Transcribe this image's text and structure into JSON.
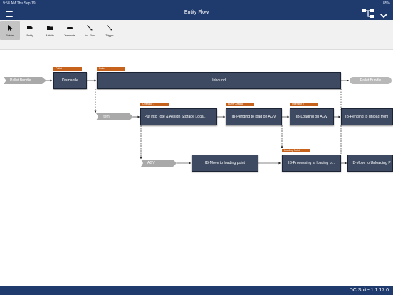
{
  "status": {
    "time": "9:58 AM",
    "date": "Thu Sep 19",
    "right": "85%"
  },
  "nav": {
    "title": "Entity Flow"
  },
  "toolbar": {
    "tools": [
      {
        "label": "Pointer"
      },
      {
        "label": "Entity"
      },
      {
        "label": "Activity"
      },
      {
        "label": "Terminate"
      },
      {
        "label": "Act. Flow"
      },
      {
        "label": "Trigger"
      }
    ]
  },
  "flow": {
    "row1": {
      "start": "Pallet Bundle",
      "tag_dismantle": "Pallet",
      "dismantle": "Dismantle",
      "tag_inbound": "Pallet",
      "inbound": "Inbound",
      "end": "Pallet Bundle"
    },
    "row2": {
      "start": "Item",
      "tag1": "Operator 1",
      "step1": "Put into Tote & Assign Storage Loca...",
      "tag2": "Buffer Area A",
      "step2": "IB-Pending to load on AGV",
      "tag3": "Operator 2",
      "step3": "IB-Loading on AGV",
      "step4": "IB-Pending to unload from"
    },
    "row3": {
      "start": "AGV",
      "step1": "IB-Move to loading point",
      "tag2": "Loading Point",
      "step2": "IB-Processing at loading p...",
      "step3": "IB-Move to Unloading P"
    }
  },
  "footer": {
    "version": "DC Suite 1.1.17.0"
  },
  "colors": {
    "nav": "#1f3a6d",
    "box": "#3d4a61",
    "tag": "#c7621c",
    "pill": "#b8b8b8"
  }
}
